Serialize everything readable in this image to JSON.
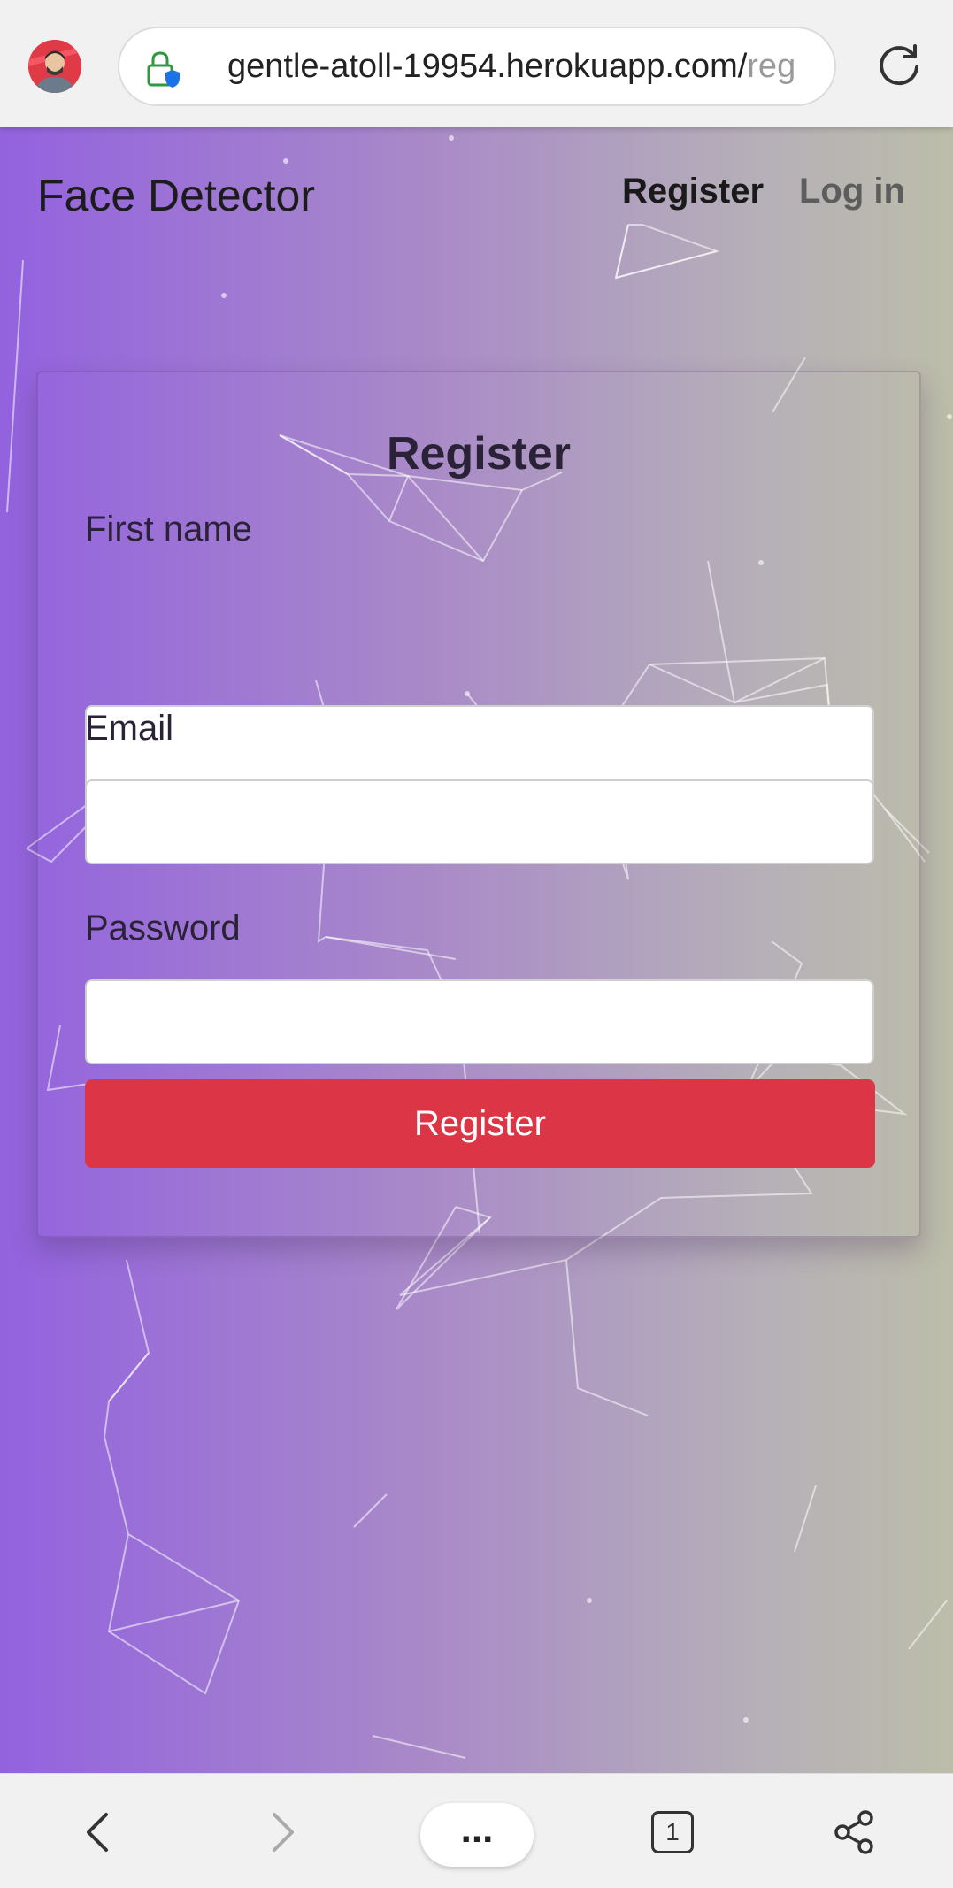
{
  "browser": {
    "url_main": "gentle-atoll-19954.herokuapp.com/",
    "url_faded": "reg",
    "tab_count": "1",
    "menu_label": "..."
  },
  "nav": {
    "brand": "Face Detector",
    "register": "Register",
    "login": "Log in"
  },
  "form": {
    "title": "Register",
    "first_name_label": "First name",
    "email_label": "Email",
    "password_label": "Password",
    "submit_label": "Register"
  },
  "colors": {
    "accent": "#dc3545",
    "gradient_start": "#9362df",
    "gradient_end": "#bcbda9"
  }
}
